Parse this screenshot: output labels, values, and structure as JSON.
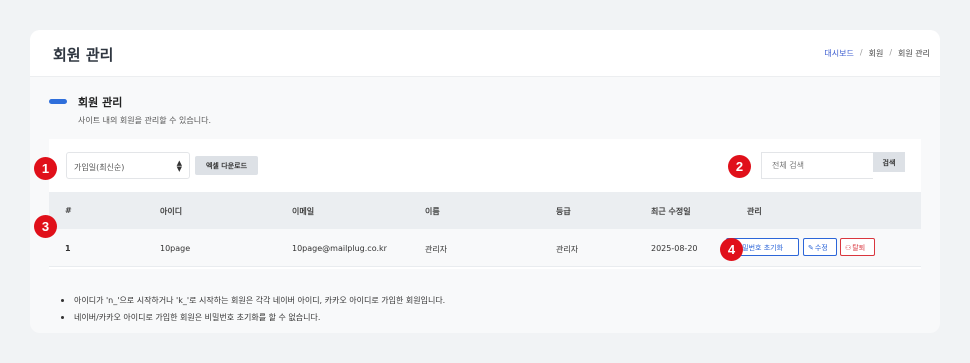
{
  "header": {
    "title": "회원 관리",
    "breadcrumb": [
      "대시보드",
      "회원",
      "회원 관리"
    ],
    "breadcrumb_sep": "/"
  },
  "section": {
    "title": "회원 관리",
    "description": "사이트 내의 회원을 관리할 수 있습니다."
  },
  "toolbar": {
    "sort_value": "가입일(최신순)",
    "sort_arrows": "▲▼",
    "excel_label": "엑셀 다운로드",
    "search_placeholder": "전체 검색",
    "search_label": "검색"
  },
  "table": {
    "columns": [
      "#",
      "아이디",
      "이메일",
      "이름",
      "등급",
      "최근 수정일",
      "관리"
    ],
    "rows": [
      {
        "num": "1",
        "id": "10page",
        "email": "10page@mailplug.co.kr",
        "name": "관리자",
        "grade": "관리자",
        "updated": "2025-08-20",
        "actions": {
          "reset": "비밀번호 초기화",
          "edit": "수정",
          "withdraw": "탈퇴"
        }
      }
    ]
  },
  "notes": [
    "아이디가 'n_'으로 시작하거나 'k_'로 시작하는 회원은 각각 네이버 아이디, 카카오 아이디로 가입한 회원입니다.",
    "네이버/카카오 아이디로 가입한 회원은 비밀번호 초기화를 할 수 없습니다."
  ],
  "annotations": [
    "1",
    "2",
    "3",
    "4"
  ],
  "colors": {
    "accent": "#2f6fdb",
    "marker": "#e0101a",
    "danger": "#d9363e"
  },
  "icons": {
    "reset": "lock-icon",
    "edit": "pencil-icon",
    "withdraw": "user-minus-icon",
    "sort": "sort-arrows-icon"
  }
}
